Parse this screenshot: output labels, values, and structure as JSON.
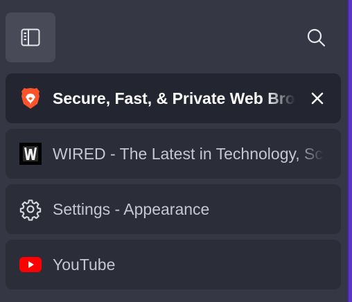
{
  "toolbar": {
    "sidebar_toggle_icon": "sidebar-panel-icon",
    "search_icon": "search-icon"
  },
  "tabs": [
    {
      "title": "Secure, Fast, & Private Web Browser with Adblocker | Brave",
      "favicon": "brave-lion-icon",
      "active": true,
      "close_icon": "close-icon"
    },
    {
      "title": "WIRED - The Latest in Technology, Science, Culture and Business",
      "favicon": "wired-logo-icon",
      "active": false
    },
    {
      "title": "Settings - Appearance",
      "favicon": "gear-icon",
      "active": false
    },
    {
      "title": "YouTube",
      "favicon": "youtube-icon",
      "active": false
    }
  ],
  "colors": {
    "background": "#353744",
    "tab": "#2b2d39",
    "active_tab": "#232531",
    "accent": "#5b35c6",
    "brave_orange": "#fb542b",
    "youtube_red": "#ff0000"
  }
}
